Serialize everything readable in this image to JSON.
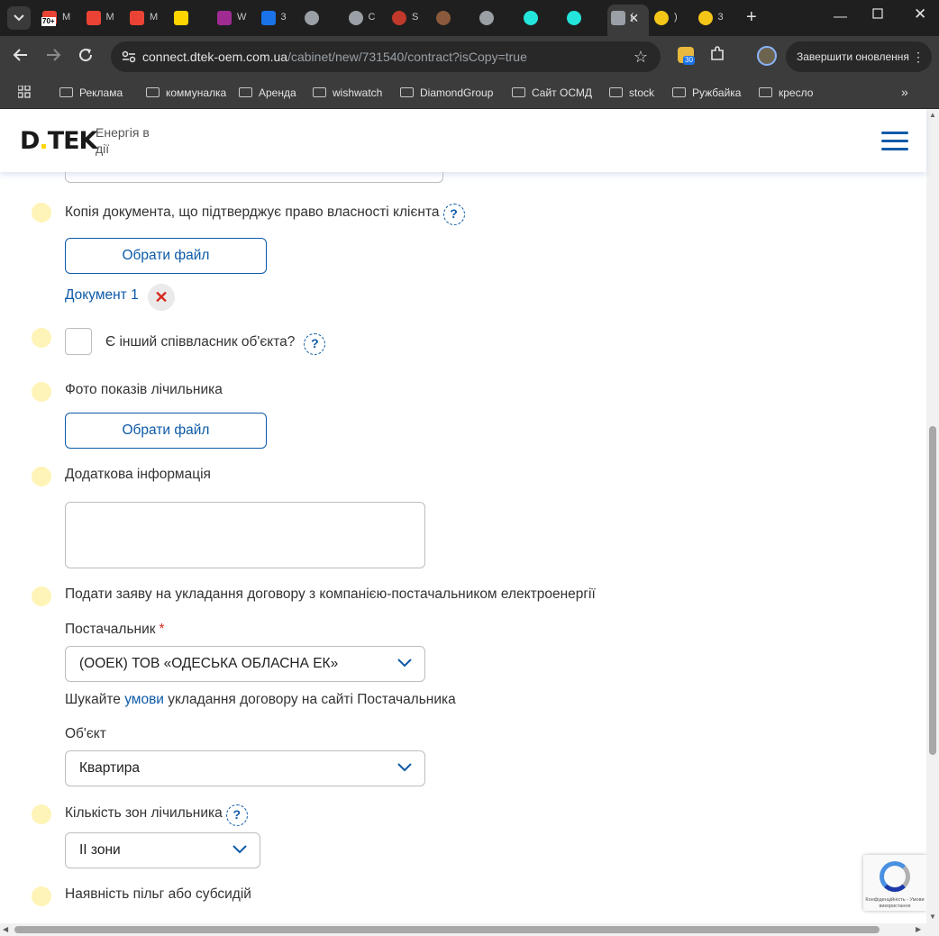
{
  "browser": {
    "tabs": [
      {
        "icon": "gmail-icon",
        "color": "#ea4335",
        "label": "M",
        "badge": "70+"
      },
      {
        "icon": "gmail-icon",
        "color": "#ea4335",
        "label": "M"
      },
      {
        "icon": "gmail-icon",
        "color": "#ea4335",
        "label": "M"
      },
      {
        "icon": "ukraine-flag-icon",
        "color": "#ffd500",
        "label": ""
      },
      {
        "icon": "wildberries-icon",
        "color": "#a02b93",
        "label": "W"
      },
      {
        "icon": "analytics-icon",
        "color": "#1a73e8",
        "label": "3"
      },
      {
        "icon": "globe-icon",
        "color": "#9aa0a6",
        "label": ""
      },
      {
        "icon": "globe-icon",
        "color": "#9aa0a6",
        "label": "C"
      },
      {
        "icon": "globe-icon",
        "color": "#c0392b",
        "label": "S"
      },
      {
        "icon": "globe-icon",
        "color": "#8b5a3c",
        "label": ""
      },
      {
        "icon": "globe-icon",
        "color": "#9aa0a6",
        "label": ""
      },
      {
        "icon": "olx-icon",
        "color": "#23e5db",
        "label": ""
      },
      {
        "icon": "olx-icon",
        "color": "#23e5db",
        "label": ""
      },
      {
        "icon": "page-icon",
        "color": "#9aa0a6",
        "label": "("
      },
      {
        "icon": "dtek-icon",
        "color": "#f5c518",
        "label": ")"
      },
      {
        "icon": "dtek-icon",
        "color": "#f5c518",
        "label": "3"
      }
    ],
    "url_host": "connect.dtek-oem.com.ua",
    "url_path": "/cabinet/new/731540/contract?isCopy=true",
    "extension_badge": "30",
    "update_button": "Завершити оновлення",
    "bookmarks": [
      "Реклама",
      "коммуналка",
      "Аренда",
      "wishwatch",
      "DiamondGroup",
      "Сайт ОСМД",
      "stock",
      "Ружбайка",
      "кресло"
    ]
  },
  "header": {
    "logo": "D.TEK",
    "tagline": "Енергія в дії"
  },
  "form": {
    "ownership_doc_label": "Копія документа, що підтверджує право власності клієнта",
    "choose_file": "Обрати файл",
    "document_name": "Документ 1",
    "remove_symbol": "✕",
    "co_owner_label": "Є інший співвласник об'єкта?",
    "help_symbol": "?",
    "meter_photo_label": "Фото показів лічильника",
    "choose_file_2": "Обрати файл",
    "additional_info_label": "Додаткова інформація",
    "additional_info_value": "",
    "apply_contract_label": "Подати заяву на укладання договору з компанією-постачальником електроенергії",
    "supplier_label": "Постачальник",
    "required_mark": "*",
    "supplier_value": "(ООЕК) ТОВ «ОДЕСЬКА ОБЛАСНА ЕК»",
    "hint_before": "Шукайте ",
    "hint_link": "умови",
    "hint_after": " укладання договору на сайті Постачальника",
    "object_label": "Об'єкт",
    "object_value": "Квартира",
    "zones_label": "Кількість зон лічильника",
    "zones_value": "II зони",
    "benefits_label": "Наявність пільг або субсидій"
  },
  "recaptcha": {
    "text": "Конфіденційність - Умови використання"
  },
  "colors": {
    "brand_blue": "#0d5aa7",
    "yellow_dot": "#fff4b8",
    "required_red": "#d52b1e"
  }
}
